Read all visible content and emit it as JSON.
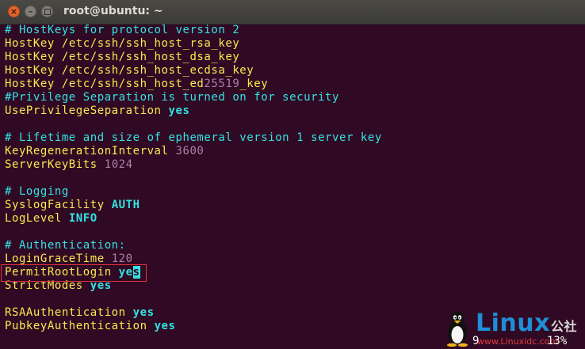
{
  "window": {
    "title": "root@ubuntu: ~",
    "close_glyph": "×",
    "minimize_glyph": "–"
  },
  "colors": {
    "background": "#300a24",
    "comment": "#34e2e2",
    "keyword": "#fce94f",
    "value": "#34e2e2",
    "number": "#ad7fa8",
    "highlight_box": "#e0333d"
  },
  "lines": {
    "l1": "# HostKeys for protocol version 2",
    "l2_kw": "HostKey",
    "l2_val": " /etc/ssh/ssh_host_rsa_key",
    "l3_kw": "HostKey",
    "l3_val": " /etc/ssh/ssh_host_dsa_key",
    "l4_kw": "HostKey",
    "l4_val": " /etc/ssh/ssh_host_ecdsa_key",
    "l5_kw": "HostKey",
    "l5_val_a": " /etc/ssh/ssh_host_ed",
    "l5_num": "25519",
    "l5_val_b": "_key",
    "l6": "#Privilege Separation is turned on for security",
    "l7_kw": "UsePrivilegeSeparation",
    "l7_val": "yes",
    "l9": "# Lifetime and size of ephemeral version 1 server key",
    "l10_kw": "KeyRegenerationInterval",
    "l10_num": "3600",
    "l11_kw": "ServerKeyBits",
    "l11_num": "1024",
    "l13": "# Logging",
    "l14_kw": "SyslogFacility",
    "l14_val": "AUTH",
    "l15_kw": "LogLevel",
    "l15_val": "INFO",
    "l17": "# Authentication:",
    "l18_kw": "LoginGraceTime",
    "l18_num": "120",
    "l19_kw": "PermitRootLogin",
    "l19_val": "ye",
    "l19_cursor": "s",
    "l20_kw": "StrictModes",
    "l20_val": "yes",
    "l22_kw": "RSAAuthentication",
    "l22_val": "yes",
    "l23_kw": "PubkeyAuthentication",
    "l23_val": "yes"
  },
  "status": {
    "line_no": "9",
    "percent": "13%"
  },
  "watermark": {
    "logo_text": "Linux",
    "logo_cn": "公社",
    "url": "www.Linuxidc.com",
    "icon": "tux-penguin-icon"
  }
}
